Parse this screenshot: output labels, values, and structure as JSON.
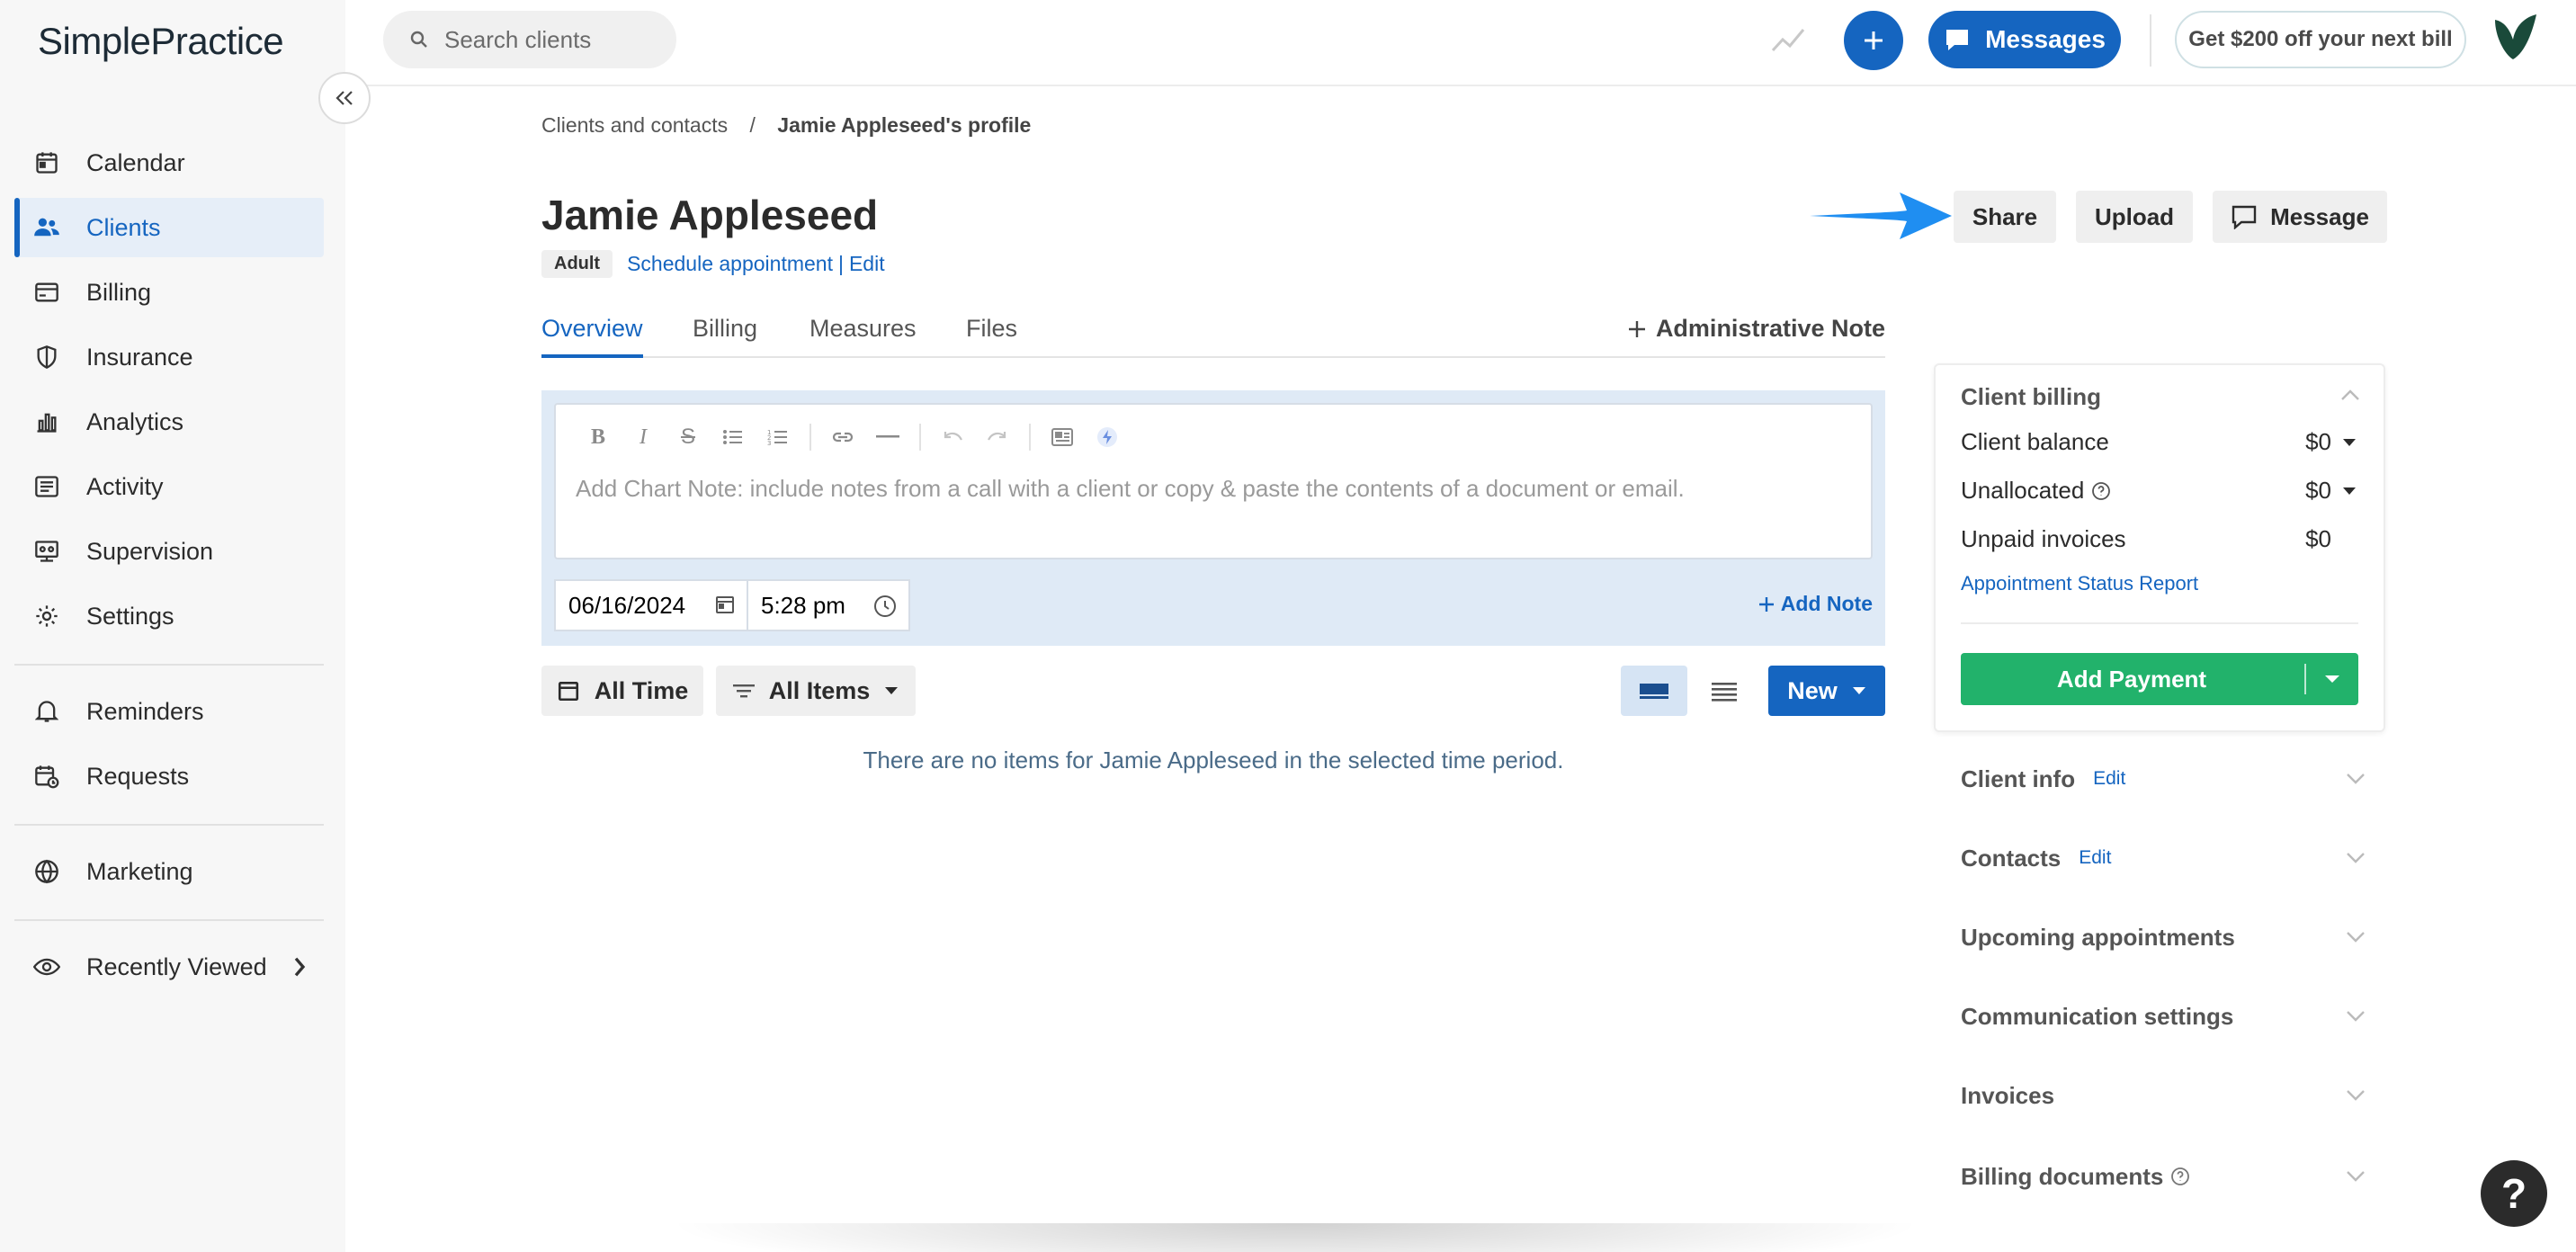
{
  "brand": {
    "name": "SimplePractice",
    "accent": "#1565c0",
    "success": "#22b26b"
  },
  "sidebar": {
    "items": [
      {
        "label": "Calendar",
        "icon": "calendar-icon"
      },
      {
        "label": "Clients",
        "icon": "clients-icon",
        "active": true
      },
      {
        "label": "Billing",
        "icon": "billing-card-icon"
      },
      {
        "label": "Insurance",
        "icon": "shield-icon"
      },
      {
        "label": "Analytics",
        "icon": "bar-chart-icon"
      },
      {
        "label": "Activity",
        "icon": "activity-list-icon"
      },
      {
        "label": "Supervision",
        "icon": "supervision-icon"
      },
      {
        "label": "Settings",
        "icon": "gear-icon"
      }
    ],
    "secondary": [
      {
        "label": "Reminders",
        "icon": "bell-icon"
      },
      {
        "label": "Requests",
        "icon": "calendar-clock-icon"
      }
    ],
    "tertiary": [
      {
        "label": "Marketing",
        "icon": "globe-icon"
      }
    ],
    "recently_viewed": {
      "label": "Recently Viewed",
      "icon": "eye-icon"
    }
  },
  "topbar": {
    "search_placeholder": "Search clients",
    "messages_label": "Messages",
    "promo_label": "Get $200 off your next bill"
  },
  "breadcrumb": {
    "parent": "Clients and contacts",
    "separator": "/",
    "current": "Jamie Appleseed's profile"
  },
  "client": {
    "name": "Jamie Appleseed",
    "badge": "Adult",
    "schedule_link": "Schedule appointment",
    "pipe": "|",
    "edit_link": "Edit"
  },
  "actions": {
    "share": "Share",
    "upload": "Upload",
    "message": "Message"
  },
  "tabs": [
    "Overview",
    "Billing",
    "Measures",
    "Files"
  ],
  "admin_note_label": "Administrative Note",
  "note": {
    "placeholder": "Add Chart Note: include notes from a call with a client or copy & paste the contents of a document or email.",
    "date": "06/16/2024",
    "time": "5:28 pm",
    "add_note_label": "Add Note"
  },
  "filters": {
    "time_label": "All Time",
    "items_label": "All Items",
    "new_label": "New"
  },
  "empty_message": "There are no items for Jamie Appleseed in the selected time period.",
  "client_billing": {
    "title": "Client billing",
    "rows": [
      {
        "label": "Client balance",
        "value": "$0"
      },
      {
        "label": "Unallocated",
        "value": "$0"
      },
      {
        "label": "Unpaid invoices",
        "value": "$0"
      }
    ],
    "status_report_link": "Appointment Status Report",
    "add_payment_label": "Add Payment"
  },
  "sections": [
    {
      "label": "Client info",
      "edit": "Edit"
    },
    {
      "label": "Contacts",
      "edit": "Edit"
    },
    {
      "label": "Upcoming appointments"
    },
    {
      "label": "Communication settings"
    },
    {
      "label": "Invoices"
    },
    {
      "label": "Billing documents"
    }
  ],
  "help_fab_label": "?"
}
